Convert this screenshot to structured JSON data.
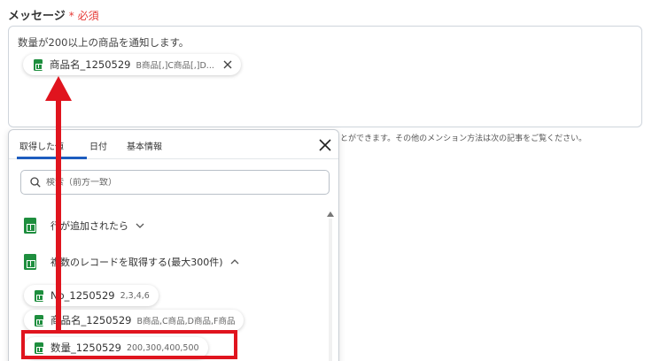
{
  "field": {
    "label": "メッセージ",
    "required_mark": "*",
    "required_text": "必須"
  },
  "message": {
    "text": "数量が200以上の商品を通知します。",
    "chip": {
      "name": "商品名_1250529",
      "values": "B商品[,]C商品[,]D..."
    }
  },
  "helper_text": "とができます。その他のメンション方法は次の記事をご覧ください。",
  "panel": {
    "tabs": [
      {
        "label": "取得した値"
      },
      {
        "label": "日付"
      },
      {
        "label": "基本情報"
      }
    ],
    "search_placeholder": "検索（前方一致）",
    "groups": [
      {
        "label": "行が追加されたら"
      },
      {
        "label": "複数のレコードを取得する(最大300件)"
      }
    ],
    "items": [
      {
        "name": "No_1250529",
        "values": "2,3,4,6"
      },
      {
        "name": "商品名_1250529",
        "values": "B商品,C商品,D商品,F商品"
      },
      {
        "name": "数量_1250529",
        "values": "200,300,400,500"
      }
    ]
  },
  "colors": {
    "accent": "#1e5dbf",
    "sheet_green": "#1e8e3e",
    "annotation_red": "#e0141e"
  },
  "icons": {
    "close": "close-icon",
    "search": "search-icon",
    "chevron_down": "chevron-down-icon",
    "chevron_up": "chevron-up-icon",
    "sheet": "sheets-icon"
  }
}
